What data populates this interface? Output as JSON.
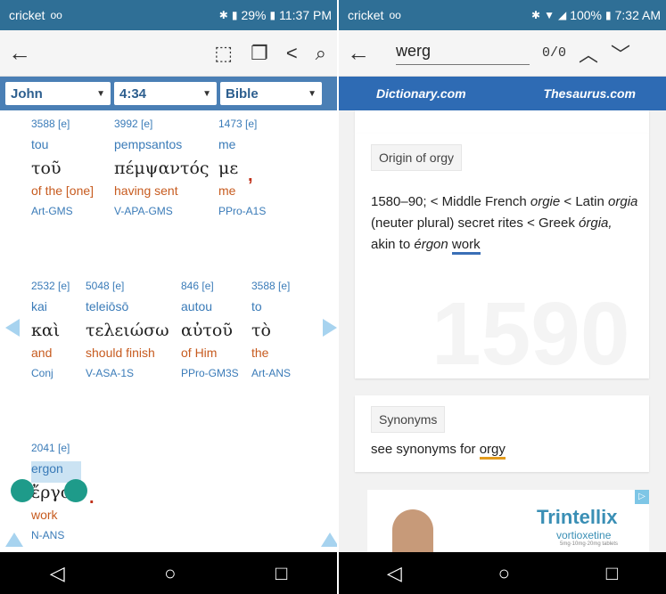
{
  "left": {
    "status": {
      "carrier": "cricket",
      "voicemail": "oo",
      "battery": "29%",
      "time": "11:37 PM"
    },
    "selectors": {
      "book": "John",
      "chapter_verse": "4:34",
      "version": "Bible"
    },
    "words": [
      {
        "num": "3588 [e]",
        "translit": "tou",
        "greek": "τοῦ",
        "eng": "of the [one]",
        "morph": "Art-GMS"
      },
      {
        "num": "3992 [e]",
        "translit": "pempsantos",
        "greek": "πέμψαντός",
        "eng": "having sent",
        "morph": "V-APA-GMS"
      },
      {
        "num": "1473 [e]",
        "translit": "me",
        "greek": "με",
        "eng": "me",
        "morph": "PPro-A1S"
      },
      {
        "num": "2532 [e]",
        "translit": "kai",
        "greek": "καὶ",
        "eng": "and",
        "morph": "Conj"
      },
      {
        "num": "5048 [e]",
        "translit": "teleiōsō",
        "greek": "τελειώσω",
        "eng": "should finish",
        "morph": "V-ASA-1S"
      },
      {
        "num": "846 [e]",
        "translit": "autou",
        "greek": "αὐτοῦ",
        "eng": "of Him",
        "morph": "PPro-GM3S"
      },
      {
        "num": "3588 [e]",
        "translit": "to",
        "greek": "τὸ",
        "eng": "the",
        "morph": "Art-ANS"
      },
      {
        "num": "2041 [e]",
        "translit": "ergon",
        "greek": "ἔργον",
        "eng": "work",
        "morph": "N-ANS"
      }
    ],
    "punct": {
      "comma": ",",
      "period": "."
    }
  },
  "right": {
    "status": {
      "carrier": "cricket",
      "voicemail": "oo",
      "battery": "100%",
      "time": "7:32 AM"
    },
    "search": {
      "query": "werg",
      "count": "0/0"
    },
    "header": {
      "dictionary": "Dictionary.com",
      "thesaurus": "Thesaurus.com"
    },
    "origin": {
      "tag": "Origin of orgy",
      "t1": "1580–90; < Middle French ",
      "t2": "orgie",
      "t3": " < Latin ",
      "t4": "orgia",
      "t5": " (neuter plural) secret rites < Greek ",
      "t6": "órgia,",
      "t7": " akin to ",
      "t8": "érgon",
      "t9": " ",
      "t10": "work",
      "watermark": "1590"
    },
    "synonyms": {
      "tag": "Synonyms",
      "text": "see synonyms for ",
      "link": "orgy"
    },
    "ad": {
      "brand": "Trintellix",
      "sub": "vortioxetine",
      "tiny": "5mg·10mg·20mg tablets",
      "badge": "▷"
    }
  },
  "nav": {
    "back": "◁",
    "home": "○",
    "recents": "□"
  }
}
